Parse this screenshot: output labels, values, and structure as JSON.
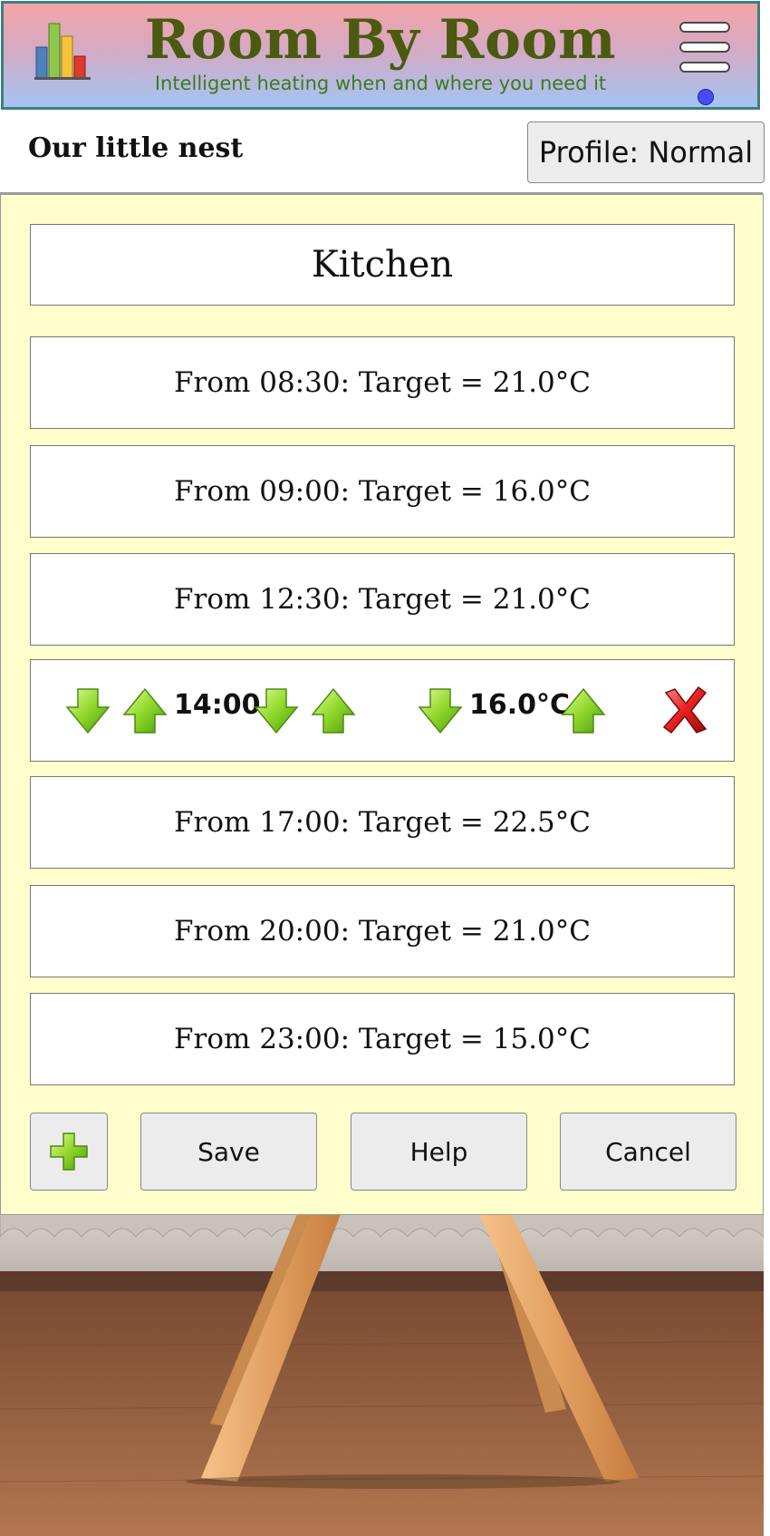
{
  "app": {
    "title": "Room By Room",
    "subtitle": "Intelligent heating when and where you need it",
    "logo_icon": "bar-chart-icon",
    "menu_icon": "hamburger-menu-icon"
  },
  "header": {
    "house_name": "Our little nest",
    "profile_button": "Profile: Normal"
  },
  "room": {
    "name": "Kitchen"
  },
  "schedule": [
    "From 08:30: Target = 21.0°C",
    "From 09:00: Target = 16.0°C",
    "From 12:30: Target = 21.0°C",
    "From 17:00: Target = 22.5°C",
    "From 20:00: Target = 21.0°C",
    "From 23:00: Target = 15.0°C"
  ],
  "edit_row": {
    "time": "14:00",
    "temperature": "16.0°C",
    "icons": {
      "decrease": "arrow-down-icon",
      "increase": "arrow-up-icon",
      "delete": "delete-x-icon"
    }
  },
  "buttons": {
    "add_icon": "plus-icon",
    "save": "Save",
    "help": "Help",
    "cancel": "Cancel"
  },
  "colors": {
    "panel_background": "#fefecc",
    "title_color": "#4b5a10",
    "subtitle_color": "#3f7a1c",
    "arrow_green": "#8bd42a",
    "delete_red": "#e02020",
    "status_dot": "#4a4af5"
  }
}
